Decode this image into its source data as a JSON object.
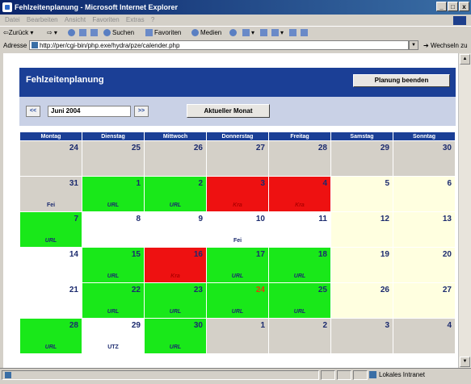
{
  "window": {
    "title": "Fehlzeitenplanung - Microsoft Internet Explorer",
    "controls": [
      "_",
      "□",
      "x"
    ]
  },
  "menubar": [
    "Datei",
    "Bearbeiten",
    "Ansicht",
    "Favoriten",
    "Extras",
    "?"
  ],
  "toolbar": {
    "back": "Zurück",
    "search": "Suchen",
    "favorites": "Favoriten",
    "media": "Medien"
  },
  "address": {
    "label": "Adresse",
    "url": "http://per/cgi-bin/php.exe/hydra/pze/calender.php",
    "go": "Wechseln zu"
  },
  "status": {
    "zone": "Lokales Intranet"
  },
  "page": {
    "title": "Fehlzeitenplanung",
    "end_button": "Planung beenden",
    "prev": "<<",
    "next": ">>",
    "month_value": "Juni 2004",
    "current_month": "Aktueller Monat"
  },
  "calendar": {
    "weekdays": [
      "Montag",
      "Dienstag",
      "Mittwoch",
      "Donnerstag",
      "Freitag",
      "Samstag",
      "Sonntag"
    ],
    "weeks": [
      [
        {
          "d": "24",
          "t": "out"
        },
        {
          "d": "25",
          "t": "out"
        },
        {
          "d": "26",
          "t": "out"
        },
        {
          "d": "27",
          "t": "out"
        },
        {
          "d": "28",
          "t": "out"
        },
        {
          "d": "29",
          "t": "out"
        },
        {
          "d": "30",
          "t": "out"
        }
      ],
      [
        {
          "d": "31",
          "t": "out",
          "c": "Fei"
        },
        {
          "d": "1",
          "t": "url",
          "c": "URL"
        },
        {
          "d": "2",
          "t": "url",
          "c": "URL"
        },
        {
          "d": "3",
          "t": "kra",
          "c": "Kra"
        },
        {
          "d": "4",
          "t": "kra",
          "c": "Kra"
        },
        {
          "d": "5",
          "t": "we"
        },
        {
          "d": "6",
          "t": "we"
        }
      ],
      [
        {
          "d": "7",
          "t": "url",
          "c": "URL"
        },
        {
          "d": "8",
          "t": "free"
        },
        {
          "d": "9",
          "t": "free"
        },
        {
          "d": "10",
          "t": "free",
          "c": "Fei"
        },
        {
          "d": "11",
          "t": "free"
        },
        {
          "d": "12",
          "t": "we"
        },
        {
          "d": "13",
          "t": "we"
        }
      ],
      [
        {
          "d": "14",
          "t": "free"
        },
        {
          "d": "15",
          "t": "url",
          "c": "URL"
        },
        {
          "d": "16",
          "t": "kra",
          "c": "Kra"
        },
        {
          "d": "17",
          "t": "url",
          "c": "URL"
        },
        {
          "d": "18",
          "t": "url",
          "c": "URL"
        },
        {
          "d": "19",
          "t": "we"
        },
        {
          "d": "20",
          "t": "we"
        }
      ],
      [
        {
          "d": "21",
          "t": "free"
        },
        {
          "d": "22",
          "t": "url",
          "c": "URL"
        },
        {
          "d": "23",
          "t": "url",
          "c": "URL"
        },
        {
          "d": "24",
          "t": "url",
          "c": "URL",
          "today": true
        },
        {
          "d": "25",
          "t": "url",
          "c": "URL"
        },
        {
          "d": "26",
          "t": "we"
        },
        {
          "d": "27",
          "t": "we"
        }
      ],
      [
        {
          "d": "28",
          "t": "url",
          "c": "URL"
        },
        {
          "d": "29",
          "t": "free",
          "c": "UTZ"
        },
        {
          "d": "30",
          "t": "url",
          "c": "URL"
        },
        {
          "d": "1",
          "t": "out"
        },
        {
          "d": "2",
          "t": "out"
        },
        {
          "d": "3",
          "t": "out"
        },
        {
          "d": "4",
          "t": "out"
        }
      ]
    ]
  },
  "colors": {
    "header": "#1b3f96",
    "nav_band": "#c9d1e6",
    "urlaub": "#19e819",
    "krank": "#ee1111",
    "weekend": "#ffffe0",
    "outside_month": "#d4d0c8",
    "today": "#e63a0a"
  }
}
